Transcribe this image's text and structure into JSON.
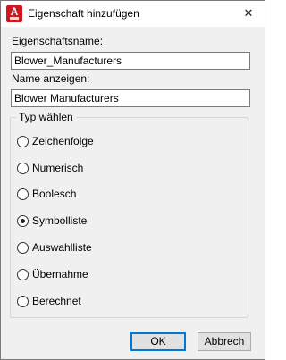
{
  "window": {
    "title": "Eigenschaft hinzufügen",
    "close_glyph": "✕",
    "app_icon_letter": "A"
  },
  "fields": {
    "property_name_label": "Eigenschaftsname:",
    "property_name_value": "Blower_Manufacturers",
    "display_name_label": "Name anzeigen:",
    "display_name_value": "Blower Manufacturers"
  },
  "type_group": {
    "title": "Typ wählen",
    "options": [
      {
        "label": "Zeichenfolge",
        "selected": false
      },
      {
        "label": "Numerisch",
        "selected": false
      },
      {
        "label": "Boolesch",
        "selected": false
      },
      {
        "label": "Symbolliste",
        "selected": true
      },
      {
        "label": "Auswahlliste",
        "selected": false
      },
      {
        "label": "Übernahme",
        "selected": false
      },
      {
        "label": "Berechnet",
        "selected": false
      }
    ]
  },
  "buttons": {
    "ok": "OK",
    "cancel": "Abbrech"
  },
  "colors": {
    "app_icon": "#d0161e",
    "default_button_border": "#0078d7"
  }
}
